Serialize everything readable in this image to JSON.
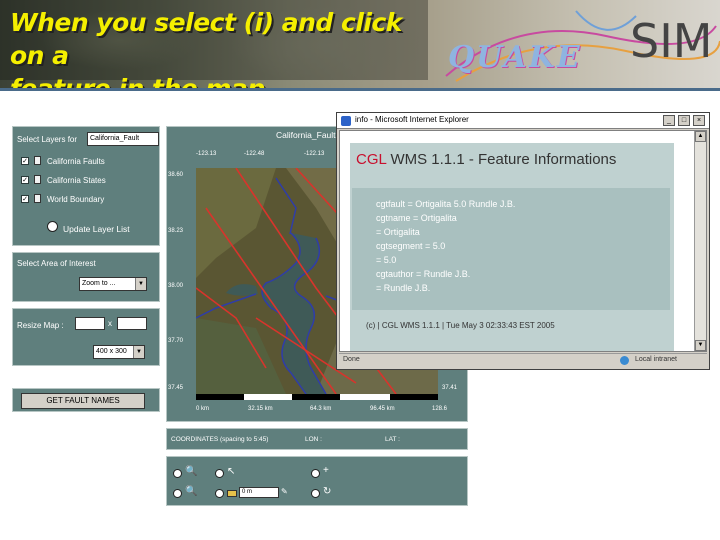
{
  "banner": {
    "title_line1": "When you select (i) and click on a",
    "title_line2": "feature in the map",
    "logo_word": "QUAKE",
    "logo_sim": "SIM"
  },
  "layers_panel": {
    "label": "Select Layers for",
    "dropdown_value": "California_Fault",
    "layers": [
      {
        "label": "California Faults",
        "checked": true
      },
      {
        "label": "California States",
        "checked": true
      },
      {
        "label": "World Boundary",
        "checked": true
      }
    ],
    "update_button": "Update Layer List"
  },
  "area_panel": {
    "label": "Select Area of Interest",
    "dropdown_value": "Zoom to ..."
  },
  "resize_panel": {
    "label": "Resize Map :",
    "x_sep": "x",
    "size_dropdown": "400 x 300"
  },
  "get_fault_button": "GET FAULT NAMES",
  "map": {
    "title": "California_Faults",
    "top_ticks": [
      "-123.13",
      "-122.48",
      "-122.13"
    ],
    "left_ticks": [
      "38.60",
      "38.23",
      "38.00",
      "37.70",
      "37.45"
    ],
    "right_ticks": [
      "37.41"
    ],
    "scale_labels": [
      "0 km",
      "32.15 km",
      "64.3 km",
      "96.45 km",
      "128.6"
    ]
  },
  "coords": {
    "label": "COORDINATES (spacing to 5:45)",
    "lon_label": "LON :",
    "lat_label": "LAT :"
  },
  "toolbar": {
    "input_value": "0 m"
  },
  "popup": {
    "window_title": "info - Microsoft Internet Explorer",
    "heading_brand": "CGL",
    "heading_rest": "WMS 1.1.1 - Feature Informations",
    "lines": [
      "cgtfault = Ortigalita 5.0 Rundle J.B.",
      "cgtname = Ortigalita",
      "= Ortigalita",
      "cgtsegment = 5.0",
      "= 5.0",
      "cgtauthor = Rundle J.B.",
      "= Rundle J.B."
    ],
    "footer": "(c) | CGL WMS 1.1.1 | Tue May 3 02:33:43 EST 2005",
    "status_left": "Done",
    "status_right": "Local intranet"
  },
  "colors": {
    "banner_title": "#f5ef00",
    "panel_bg": "#5f7f7d",
    "brand_red": "#c8102e",
    "fault_lines": "#d8342c",
    "boundary_lines": "#2f3da8"
  }
}
